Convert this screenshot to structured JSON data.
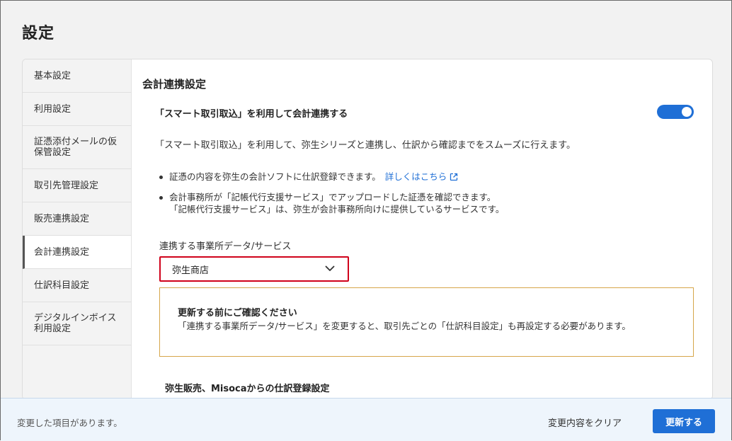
{
  "page": {
    "title": "設定"
  },
  "sidebar": {
    "items": [
      {
        "label": "基本設定"
      },
      {
        "label": "利用設定"
      },
      {
        "label": "証憑添付メールの仮保管設定"
      },
      {
        "label": "取引先管理設定"
      },
      {
        "label": "販売連携設定"
      },
      {
        "label": "会計連携設定",
        "active": true
      },
      {
        "label": "仕訳科目設定"
      },
      {
        "label": "デジタルインボイス利用設定"
      }
    ]
  },
  "main": {
    "section_title": "会計連携設定",
    "toggle": {
      "label": "「スマート取引取込」を利用して会計連携する",
      "on": true,
      "color": "#1f6fd6"
    },
    "description": "「スマート取引取込」を利用して、弥生シリーズと連携し、仕訳から確認までをスムーズに行えます。",
    "bullets": [
      {
        "text": "証憑の内容を弥生の会計ソフトに仕訳登録できます。",
        "link": "詳しくはこちら"
      },
      {
        "line1": "会計事務所が「記帳代行支援サービス」でアップロードした証憑を確認できます。",
        "line2": "「記帳代行支援サービス」は、弥生が会計事務所向けに提供しているサービスです。"
      }
    ],
    "select": {
      "label": "連携する事業所データ/サービス",
      "value": "弥生商店"
    },
    "notice": {
      "title": "更新する前にご確認ください",
      "body": "「連携する事業所データ/サービス」を変更すると、取引先ごとの「仕訳科目設定」も再設定する必要があります。"
    },
    "subsection_title": "弥生販売、Misocaからの仕訳登録設定"
  },
  "footer": {
    "status": "変更した項目があります。",
    "clear_label": "変更内容をクリア",
    "update_label": "更新する"
  },
  "colors": {
    "accent": "#1f6fd6",
    "highlight_border": "#d0021b",
    "notice_border": "#d6a64a"
  }
}
